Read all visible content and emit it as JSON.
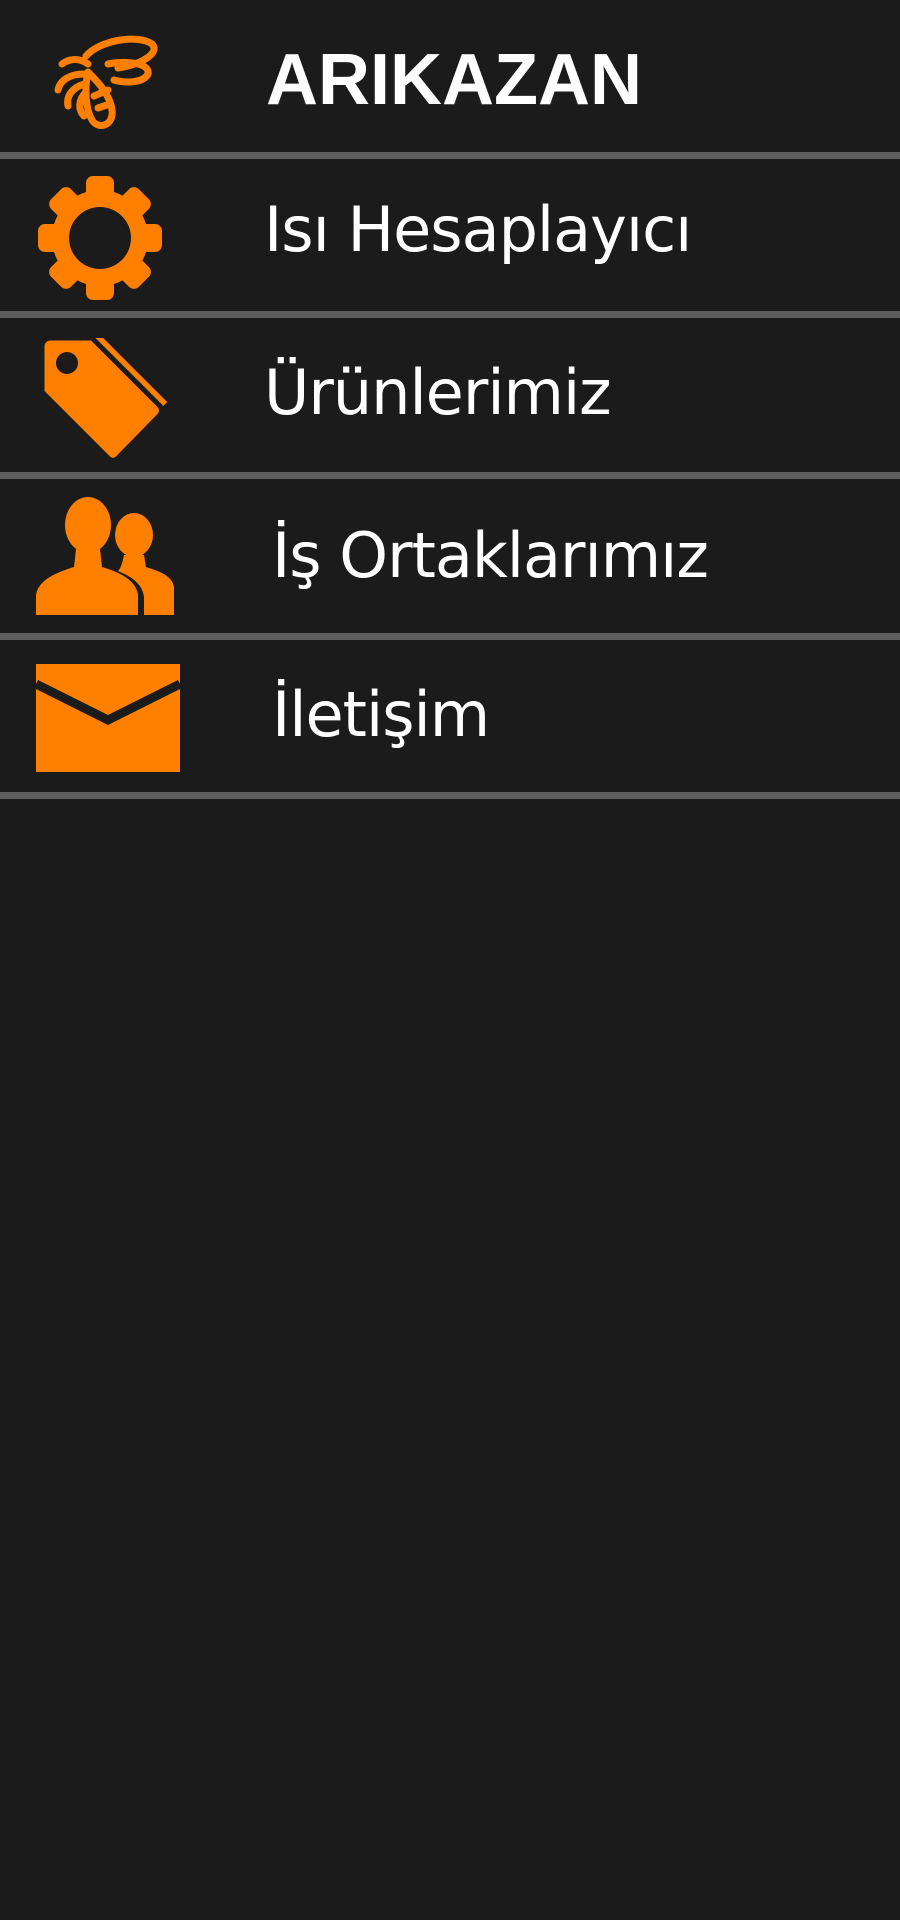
{
  "header": {
    "title": "ARIKAZAN",
    "logo_icon": "bee-icon"
  },
  "menu": {
    "items": [
      {
        "label": "Isı Hesaplayıcı",
        "icon": "gear-icon"
      },
      {
        "label": "Ürünlerimiz",
        "icon": "tags-icon"
      },
      {
        "label": "İş Ortaklarımız",
        "icon": "users-icon"
      },
      {
        "label": "İletişim",
        "icon": "envelope-icon"
      }
    ]
  },
  "colors": {
    "background": "#1b1b1b",
    "accent": "#ff7f00",
    "divider": "#5d5d5d",
    "text": "#ffffff"
  }
}
